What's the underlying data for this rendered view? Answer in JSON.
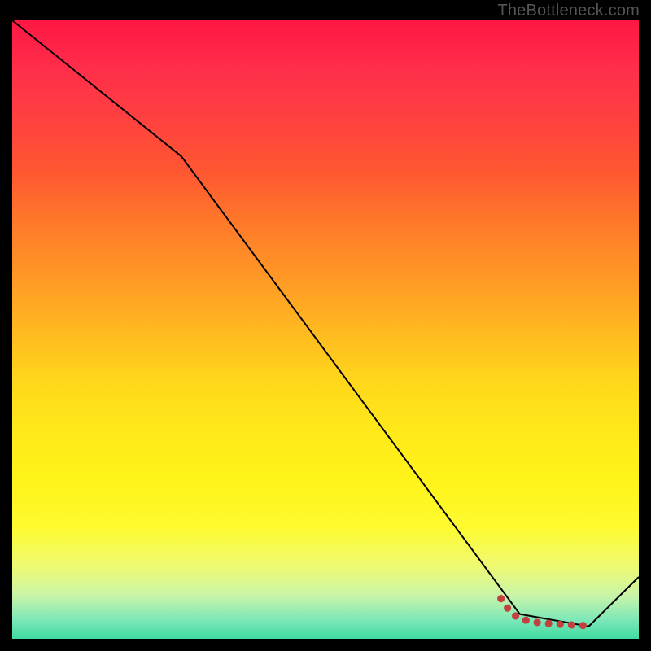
{
  "attribution": "TheBottleneck.com",
  "chart_data": {
    "type": "line",
    "title": "",
    "xlabel": "",
    "ylabel": "",
    "xlim": [
      0,
      100
    ],
    "ylim": [
      0,
      100
    ],
    "series": [
      {
        "name": "black-curve",
        "color": "#000000",
        "x": [
          0,
          27,
          81,
          92,
          100
        ],
        "y": [
          100,
          78,
          4,
          2,
          10
        ]
      },
      {
        "name": "red-curve",
        "color": "#c0413f",
        "x": [
          78,
          79.5,
          81,
          84,
          88,
          92
        ],
        "y": [
          6.5,
          4.3,
          3.2,
          2.6,
          2.3,
          2.1
        ]
      }
    ]
  }
}
